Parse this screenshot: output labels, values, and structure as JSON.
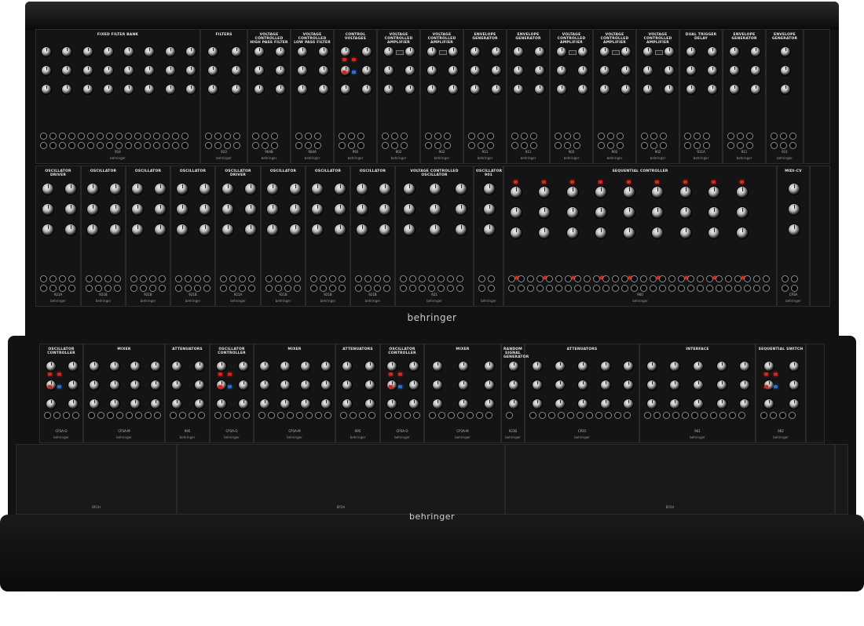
{
  "brand": "behringer",
  "upper_row": [
    {
      "title": "FIXED FILTER BANK",
      "num": "914",
      "w": 210
    },
    {
      "title": "FILTERS",
      "num": "923",
      "w": 60
    },
    {
      "title": "VOLTAGE CONTROLLED HIGH PASS FILTER",
      "num": "904B",
      "w": 55
    },
    {
      "title": "VOLTAGE CONTROLLED LOW PASS FILTER",
      "num": "904A",
      "w": 55
    },
    {
      "title": "CONTROL VOLTAGES",
      "num": "992",
      "w": 55
    },
    {
      "title": "VOLTAGE CONTROLLED AMPLIFIER",
      "num": "902",
      "w": 55
    },
    {
      "title": "VOLTAGE CONTROLLED AMPLIFIER",
      "num": "902",
      "w": 55
    },
    {
      "title": "ENVELOPE GENERATOR",
      "num": "911",
      "w": 55
    },
    {
      "title": "ENVELOPE GENERATOR",
      "num": "911",
      "w": 55
    },
    {
      "title": "VOLTAGE CONTROLLED AMPLIFIER",
      "num": "902",
      "w": 55
    },
    {
      "title": "VOLTAGE CONTROLLED AMPLIFIER",
      "num": "902",
      "w": 55
    },
    {
      "title": "VOLTAGE CONTROLLED AMPLIFIER",
      "num": "902",
      "w": 55
    },
    {
      "title": "DUAL TRIGGER DELAY",
      "num": "911A",
      "w": 55
    },
    {
      "title": "ENVELOPE GENERATOR",
      "num": "911",
      "w": 55
    },
    {
      "title": "ENVELOPE GENERATOR",
      "num": "911",
      "w": 48
    }
  ],
  "middle_row": [
    {
      "title": "OSCILLATOR DRIVER",
      "num": "921A",
      "w": 58
    },
    {
      "title": "OSCILLATOR",
      "num": "921B",
      "w": 57
    },
    {
      "title": "OSCILLATOR",
      "num": "921B",
      "w": 57
    },
    {
      "title": "OSCILLATOR",
      "num": "921B",
      "w": 57
    },
    {
      "title": "OSCILLATOR DRIVER",
      "num": "921A",
      "w": 58
    },
    {
      "title": "OSCILLATOR",
      "num": "921B",
      "w": 57
    },
    {
      "title": "OSCILLATOR",
      "num": "921B",
      "w": 57
    },
    {
      "title": "OSCILLATOR",
      "num": "921B",
      "w": 57
    },
    {
      "title": "VOLTAGE CONTROLLED OSCILLATOR",
      "num": "921",
      "w": 100
    },
    {
      "title": "OSCILLATOR 901",
      "num": "",
      "w": 38
    },
    {
      "title": "SEQUENTIAL CONTROLLER",
      "num": "960",
      "w": 348
    },
    {
      "title": "MIDI-CV",
      "num": "CP3A",
      "w": 42
    }
  ],
  "lower_row": [
    {
      "title": "OSCILLATOR CONTROLLER",
      "num": "CP3A-O",
      "w": 56
    },
    {
      "title": "MIXER",
      "num": "CP3A-M",
      "w": 104
    },
    {
      "title": "ATTENUATORS",
      "num": "995",
      "w": 57
    },
    {
      "title": "OSCILLATOR CONTROLLER",
      "num": "CP3A-O",
      "w": 56
    },
    {
      "title": "MIXER",
      "num": "CP3A-M",
      "w": 104
    },
    {
      "title": "ATTENUATORS",
      "num": "995",
      "w": 57
    },
    {
      "title": "OSCILLATOR CONTROLLER",
      "num": "CP3A-O",
      "w": 56
    },
    {
      "title": "MIXER",
      "num": "CP3A-M",
      "w": 98
    },
    {
      "title": "RANDOM SIGNAL GENERATOR",
      "num": "923B",
      "w": 30
    },
    {
      "title": "ATTENUATORS",
      "num": "CP35",
      "w": 146
    },
    {
      "title": "INTERFACE",
      "num": "961",
      "w": 148
    },
    {
      "title": "SEQUENTIAL SWITCH",
      "num": "962",
      "w": 64
    }
  ],
  "blank_panels": [
    {
      "label": "BP2H",
      "w": 205
    },
    {
      "label": "BP2H",
      "w": 418
    },
    {
      "label": "BP2H",
      "w": 420
    }
  ],
  "colors": {
    "panel": "#141414",
    "cabinet": "#0f0f0f",
    "side_accent": "#7a1613",
    "led_red": "#d8261c",
    "led_blue": "#2a6fd6",
    "knob_cap": "#e8e8e8"
  }
}
